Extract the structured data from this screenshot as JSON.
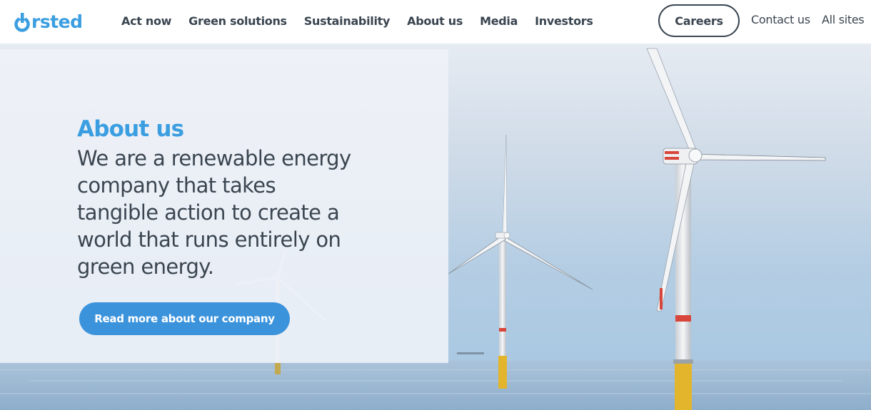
{
  "brand": {
    "name": "Ørsted",
    "logo_text": "rsted",
    "color": "#3b9ee0"
  },
  "nav": {
    "items": [
      {
        "label": "Act now"
      },
      {
        "label": "Green solutions"
      },
      {
        "label": "Sustainability"
      },
      {
        "label": "About us"
      },
      {
        "label": "Media"
      },
      {
        "label": "Investors"
      }
    ]
  },
  "utility": {
    "careers_label": "Careers",
    "contact_label": "Contact us",
    "all_sites_label": "All sites"
  },
  "hero": {
    "eyebrow": "About us",
    "lead": "We are a renewable energy company that takes tangible action to create a world that runs entirely on green energy.",
    "cta_label": "Read more about our company",
    "image": "offshore-wind-turbines-photo"
  },
  "colors": {
    "text": "#3a4550",
    "accent": "#3b9ee0",
    "button": "#3b93dc"
  }
}
